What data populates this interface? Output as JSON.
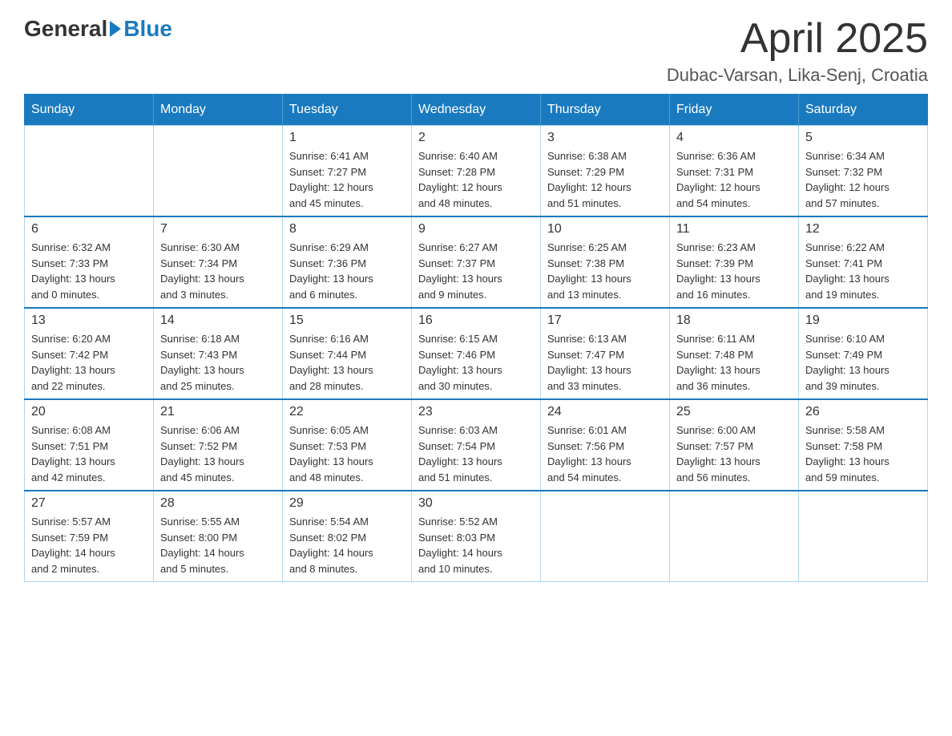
{
  "header": {
    "logo_general": "General",
    "logo_blue": "Blue",
    "month_title": "April 2025",
    "location": "Dubac-Varsan, Lika-Senj, Croatia"
  },
  "weekdays": [
    "Sunday",
    "Monday",
    "Tuesday",
    "Wednesday",
    "Thursday",
    "Friday",
    "Saturday"
  ],
  "weeks": [
    [
      {
        "day": "",
        "info": ""
      },
      {
        "day": "",
        "info": ""
      },
      {
        "day": "1",
        "info": "Sunrise: 6:41 AM\nSunset: 7:27 PM\nDaylight: 12 hours\nand 45 minutes."
      },
      {
        "day": "2",
        "info": "Sunrise: 6:40 AM\nSunset: 7:28 PM\nDaylight: 12 hours\nand 48 minutes."
      },
      {
        "day": "3",
        "info": "Sunrise: 6:38 AM\nSunset: 7:29 PM\nDaylight: 12 hours\nand 51 minutes."
      },
      {
        "day": "4",
        "info": "Sunrise: 6:36 AM\nSunset: 7:31 PM\nDaylight: 12 hours\nand 54 minutes."
      },
      {
        "day": "5",
        "info": "Sunrise: 6:34 AM\nSunset: 7:32 PM\nDaylight: 12 hours\nand 57 minutes."
      }
    ],
    [
      {
        "day": "6",
        "info": "Sunrise: 6:32 AM\nSunset: 7:33 PM\nDaylight: 13 hours\nand 0 minutes."
      },
      {
        "day": "7",
        "info": "Sunrise: 6:30 AM\nSunset: 7:34 PM\nDaylight: 13 hours\nand 3 minutes."
      },
      {
        "day": "8",
        "info": "Sunrise: 6:29 AM\nSunset: 7:36 PM\nDaylight: 13 hours\nand 6 minutes."
      },
      {
        "day": "9",
        "info": "Sunrise: 6:27 AM\nSunset: 7:37 PM\nDaylight: 13 hours\nand 9 minutes."
      },
      {
        "day": "10",
        "info": "Sunrise: 6:25 AM\nSunset: 7:38 PM\nDaylight: 13 hours\nand 13 minutes."
      },
      {
        "day": "11",
        "info": "Sunrise: 6:23 AM\nSunset: 7:39 PM\nDaylight: 13 hours\nand 16 minutes."
      },
      {
        "day": "12",
        "info": "Sunrise: 6:22 AM\nSunset: 7:41 PM\nDaylight: 13 hours\nand 19 minutes."
      }
    ],
    [
      {
        "day": "13",
        "info": "Sunrise: 6:20 AM\nSunset: 7:42 PM\nDaylight: 13 hours\nand 22 minutes."
      },
      {
        "day": "14",
        "info": "Sunrise: 6:18 AM\nSunset: 7:43 PM\nDaylight: 13 hours\nand 25 minutes."
      },
      {
        "day": "15",
        "info": "Sunrise: 6:16 AM\nSunset: 7:44 PM\nDaylight: 13 hours\nand 28 minutes."
      },
      {
        "day": "16",
        "info": "Sunrise: 6:15 AM\nSunset: 7:46 PM\nDaylight: 13 hours\nand 30 minutes."
      },
      {
        "day": "17",
        "info": "Sunrise: 6:13 AM\nSunset: 7:47 PM\nDaylight: 13 hours\nand 33 minutes."
      },
      {
        "day": "18",
        "info": "Sunrise: 6:11 AM\nSunset: 7:48 PM\nDaylight: 13 hours\nand 36 minutes."
      },
      {
        "day": "19",
        "info": "Sunrise: 6:10 AM\nSunset: 7:49 PM\nDaylight: 13 hours\nand 39 minutes."
      }
    ],
    [
      {
        "day": "20",
        "info": "Sunrise: 6:08 AM\nSunset: 7:51 PM\nDaylight: 13 hours\nand 42 minutes."
      },
      {
        "day": "21",
        "info": "Sunrise: 6:06 AM\nSunset: 7:52 PM\nDaylight: 13 hours\nand 45 minutes."
      },
      {
        "day": "22",
        "info": "Sunrise: 6:05 AM\nSunset: 7:53 PM\nDaylight: 13 hours\nand 48 minutes."
      },
      {
        "day": "23",
        "info": "Sunrise: 6:03 AM\nSunset: 7:54 PM\nDaylight: 13 hours\nand 51 minutes."
      },
      {
        "day": "24",
        "info": "Sunrise: 6:01 AM\nSunset: 7:56 PM\nDaylight: 13 hours\nand 54 minutes."
      },
      {
        "day": "25",
        "info": "Sunrise: 6:00 AM\nSunset: 7:57 PM\nDaylight: 13 hours\nand 56 minutes."
      },
      {
        "day": "26",
        "info": "Sunrise: 5:58 AM\nSunset: 7:58 PM\nDaylight: 13 hours\nand 59 minutes."
      }
    ],
    [
      {
        "day": "27",
        "info": "Sunrise: 5:57 AM\nSunset: 7:59 PM\nDaylight: 14 hours\nand 2 minutes."
      },
      {
        "day": "28",
        "info": "Sunrise: 5:55 AM\nSunset: 8:00 PM\nDaylight: 14 hours\nand 5 minutes."
      },
      {
        "day": "29",
        "info": "Sunrise: 5:54 AM\nSunset: 8:02 PM\nDaylight: 14 hours\nand 8 minutes."
      },
      {
        "day": "30",
        "info": "Sunrise: 5:52 AM\nSunset: 8:03 PM\nDaylight: 14 hours\nand 10 minutes."
      },
      {
        "day": "",
        "info": ""
      },
      {
        "day": "",
        "info": ""
      },
      {
        "day": "",
        "info": ""
      }
    ]
  ]
}
